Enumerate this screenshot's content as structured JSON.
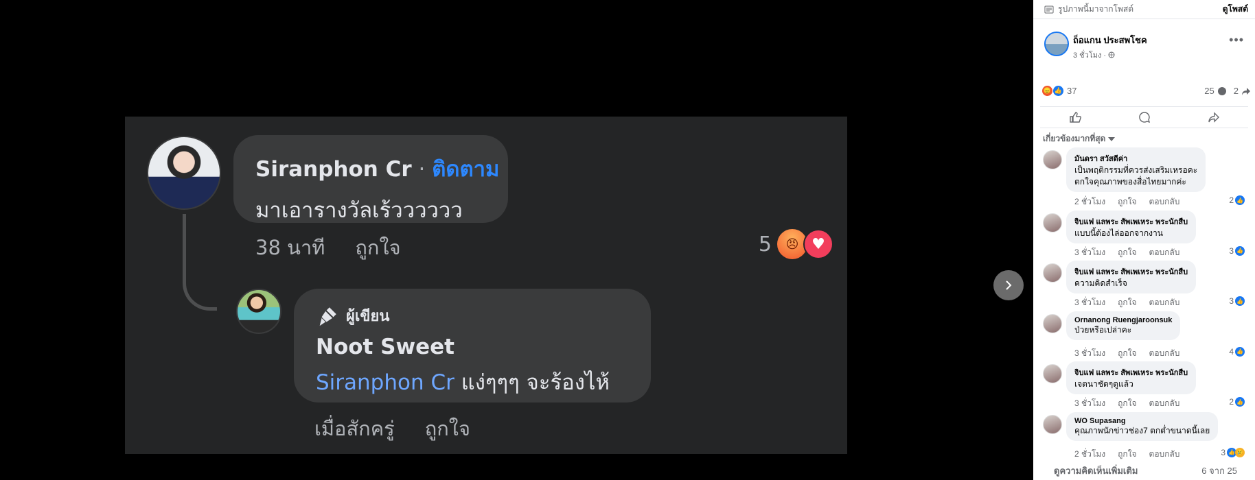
{
  "photo": {
    "comment": {
      "name": "Siranphon Cr",
      "separator": " · ",
      "follow_label": "ติดตาม",
      "text": "มาเอารางวัลเร้วววววว",
      "time": "38 นาที",
      "like_label": "ถูกใจ",
      "reaction_count": "5"
    },
    "reply": {
      "author_badge": "ผู้เขียน",
      "name": "Noot Sweet",
      "mention": "Siranphon Cr",
      "text": " แง่ๆๆๆ จะร้องไห้",
      "time": "เมื่อสักครู่",
      "like_label": "ถูกใจ"
    }
  },
  "sidebar": {
    "top_label": "รูปภาพนี้มาจากโพสต์",
    "view_post": "ดูโพสต์",
    "post": {
      "author": "ถ็อแกน ประสพโชค",
      "time": "3 ชั่วโมง ·",
      "reactions_count": "37",
      "comments_count": "25",
      "shares_count": "2"
    },
    "sort_label": "เกี่ยวข้องมากที่สุด",
    "comments": [
      {
        "name": "มันดรา สวัสดีค่า",
        "lines": [
          "เป็นพฤติกรรมที่ควรส่งเสริมเหรอคะ",
          "ตกใจคุณภาพของสื่อไทยมากค่ะ"
        ],
        "time": "2 ชั่วโมง",
        "like": "ถูกใจ",
        "reply": "ตอบกลับ",
        "likes": "2"
      },
      {
        "name": "จิบแฟ แลพระ สัพเพเหระ พระนักสืบ",
        "lines": [
          "แบบนี้ต้องไล่ออกจากงาน"
        ],
        "time": "3 ชั่วโมง",
        "like": "ถูกใจ",
        "reply": "ตอบกลับ",
        "likes": "3"
      },
      {
        "name": "จิบแฟ แลพระ สัพเพเหระ พระนักสืบ",
        "lines": [
          "ความคิดสำเร็จ"
        ],
        "time": "3 ชั่วโมง",
        "like": "ถูกใจ",
        "reply": "ตอบกลับ",
        "likes": "3"
      },
      {
        "name": "Ornanong Ruengjaroonsuk",
        "lines": [
          "ป่วยหรือเปล่าคะ"
        ],
        "time": "3 ชั่วโมง",
        "like": "ถูกใจ",
        "reply": "ตอบกลับ",
        "likes": "4"
      },
      {
        "name": "จิบแฟ แลพระ สัพเพเหระ พระนักสืบ",
        "lines": [
          "เจตนาชัดๆดูแล้ว"
        ],
        "time": "3 ชั่วโมง",
        "like": "ถูกใจ",
        "reply": "ตอบกลับ",
        "likes": "2"
      },
      {
        "name": "WO Supasang",
        "lines": [
          "คุณภาพนักข่าวช่อง7 ตกต่ำขนาดนี้เลย"
        ],
        "time": "2 ชั่วโมง",
        "like": "ถูกใจ",
        "reply": "ตอบกลับ",
        "likes": "3"
      }
    ],
    "footer": {
      "more_comments": "ดูความคิดเห็นเพิ่มเติม",
      "count": "6 จาก 25"
    }
  }
}
